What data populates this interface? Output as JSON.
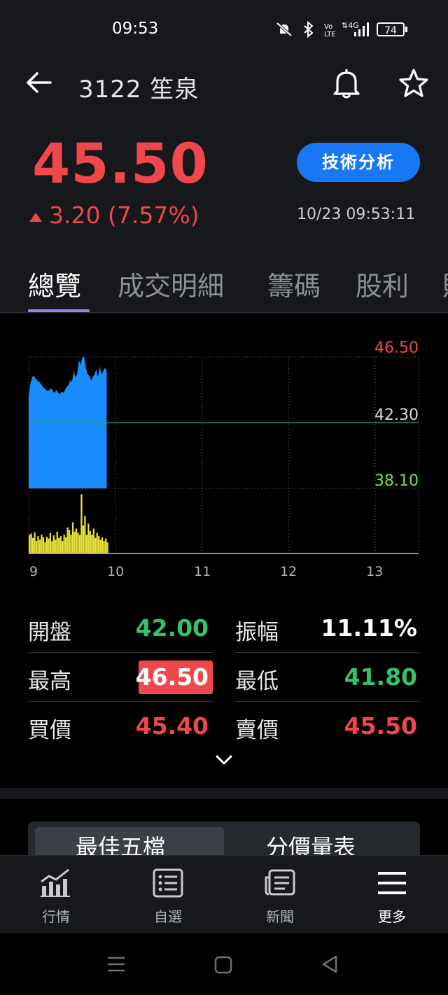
{
  "status_bar": {
    "time": "09:53",
    "battery": "74",
    "icons": [
      "mute-bell-icon",
      "bluetooth-icon",
      "volte-icon",
      "4g-signal-icon",
      "battery-icon"
    ]
  },
  "header": {
    "title": "3122 笙泉",
    "icons": [
      "back-arrow-icon",
      "bell-icon",
      "star-icon"
    ]
  },
  "quote": {
    "price": "45.50",
    "change": "3.20 (7.57%)",
    "datetime": "10/23 09:53:11",
    "tech_button": "技術分析",
    "colors": {
      "up": "#f0474d",
      "down": "#34c36a",
      "accent": "#1877f2"
    }
  },
  "tabs": [
    "總覽",
    "成交明細",
    "籌碼",
    "股利",
    "財"
  ],
  "chart_data": {
    "type": "area",
    "price_axis": {
      "high": "46.50",
      "mid": "42.30",
      "low": "38.10"
    },
    "ylim": [
      38.1,
      46.5
    ],
    "reference": 42.3,
    "x_ticks": [
      "9",
      "10",
      "11",
      "12",
      "13"
    ],
    "xlim": [
      9,
      13.5
    ],
    "price_series": {
      "x": [
        9.0,
        9.02,
        9.04,
        9.06,
        9.08,
        9.1,
        9.12,
        9.14,
        9.16,
        9.18,
        9.2,
        9.22,
        9.24,
        9.26,
        9.28,
        9.3,
        9.32,
        9.34,
        9.36,
        9.38,
        9.4,
        9.42,
        9.44,
        9.46,
        9.48,
        9.5,
        9.52,
        9.54,
        9.56,
        9.58,
        9.6,
        9.62,
        9.64,
        9.66,
        9.68,
        9.7,
        9.72,
        9.74,
        9.76,
        9.78,
        9.8,
        9.82,
        9.84,
        9.86,
        9.88,
        9.9
      ],
      "values": [
        44.0,
        44.8,
        45.2,
        45.3,
        45.1,
        45.0,
        44.9,
        44.8,
        44.6,
        44.5,
        44.4,
        44.3,
        44.4,
        44.5,
        44.3,
        44.2,
        44.4,
        44.2,
        44.1,
        44.3,
        44.2,
        44.4,
        44.6,
        44.7,
        45.0,
        44.9,
        45.6,
        45.2,
        45.4,
        46.3,
        46.0,
        46.5,
        46.5,
        45.8,
        45.4,
        45.3,
        45.0,
        45.2,
        45.4,
        45.7,
        45.2,
        45.9,
        45.4,
        45.6,
        45.8,
        45.6
      ]
    },
    "volume_series": {
      "x": [
        9.0,
        9.02,
        9.04,
        9.06,
        9.08,
        9.1,
        9.12,
        9.14,
        9.16,
        9.18,
        9.2,
        9.22,
        9.24,
        9.26,
        9.28,
        9.3,
        9.32,
        9.34,
        9.36,
        9.38,
        9.4,
        9.42,
        9.44,
        9.46,
        9.48,
        9.5,
        9.52,
        9.54,
        9.56,
        9.58,
        9.6,
        9.62,
        9.64,
        9.66,
        9.68,
        9.7,
        9.72,
        9.74,
        9.76,
        9.78,
        9.8,
        9.82,
        9.84,
        9.86,
        9.88,
        9.9
      ],
      "values": [
        0.3,
        0.32,
        0.25,
        0.34,
        0.2,
        0.28,
        0.22,
        0.3,
        0.26,
        0.18,
        0.27,
        0.24,
        0.33,
        0.2,
        0.29,
        0.22,
        0.35,
        0.25,
        0.28,
        0.2,
        0.3,
        0.26,
        0.42,
        0.38,
        0.3,
        0.5,
        0.35,
        0.4,
        0.33,
        0.3,
        0.95,
        0.45,
        0.6,
        0.3,
        0.48,
        0.36,
        0.3,
        0.4,
        0.25,
        0.33,
        0.28,
        0.22,
        0.26,
        0.2,
        0.24,
        0.18
      ]
    }
  },
  "stats": {
    "open_label": "開盤",
    "open": "42.00",
    "amp_label": "振幅",
    "amp": "11.11%",
    "high_label": "最高",
    "high": "46.50",
    "low_label": "最低",
    "low": "41.80",
    "bid_label": "買價",
    "bid": "45.40",
    "ask_label": "賣價",
    "ask": "45.50"
  },
  "segments": [
    "最佳五檔",
    "分價量表"
  ],
  "bottom_nav": [
    {
      "label": "行情",
      "icon": "chart-icon"
    },
    {
      "label": "自選",
      "icon": "list-icon"
    },
    {
      "label": "新聞",
      "icon": "news-icon"
    },
    {
      "label": "更多",
      "icon": "menu-icon"
    }
  ],
  "system_nav": [
    "recents-icon",
    "home-icon",
    "back-icon"
  ]
}
